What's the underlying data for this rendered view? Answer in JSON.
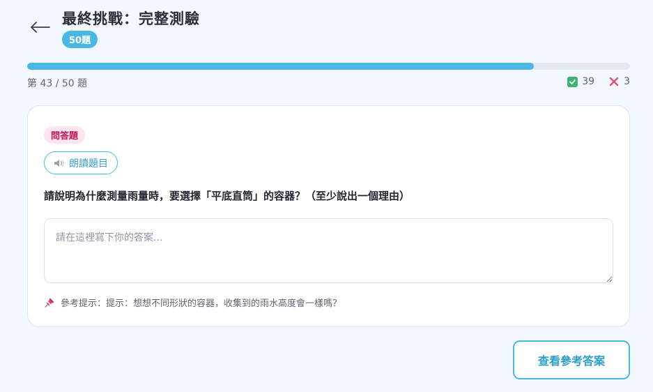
{
  "header": {
    "title": "最終挑戰：完整測驗",
    "count_badge": "50題"
  },
  "progress": {
    "current": 43,
    "total": 50,
    "fraction": 0.84,
    "label": "第 43 / 50 題"
  },
  "score": {
    "correct": "39",
    "wrong": "3"
  },
  "question": {
    "type_label": "問答題",
    "read_aloud_label": "朗讀題目",
    "text": "請說明為什麼測量雨量時，要選擇「平底直筒」的容器？（至少說出一個理由）",
    "answer_placeholder": "請在這裡寫下你的答案...",
    "answer_value": "",
    "hint_text": "參考提示：提示：想想不同形狀的容器，收集到的雨水高度會一樣嗎？"
  },
  "actions": {
    "view_answer_label": "查看參考答案"
  },
  "colors": {
    "accent": "#4ab8e3",
    "correct": "#3cb371",
    "wrong": "#e0557a",
    "type_tag_bg": "#fde4ee",
    "type_tag_text": "#c2185b"
  },
  "icons": {
    "back": "arrow-left-icon",
    "correct": "check-box-icon",
    "wrong": "cross-icon",
    "speaker": "speaker-icon",
    "hint": "pushpin-icon"
  }
}
